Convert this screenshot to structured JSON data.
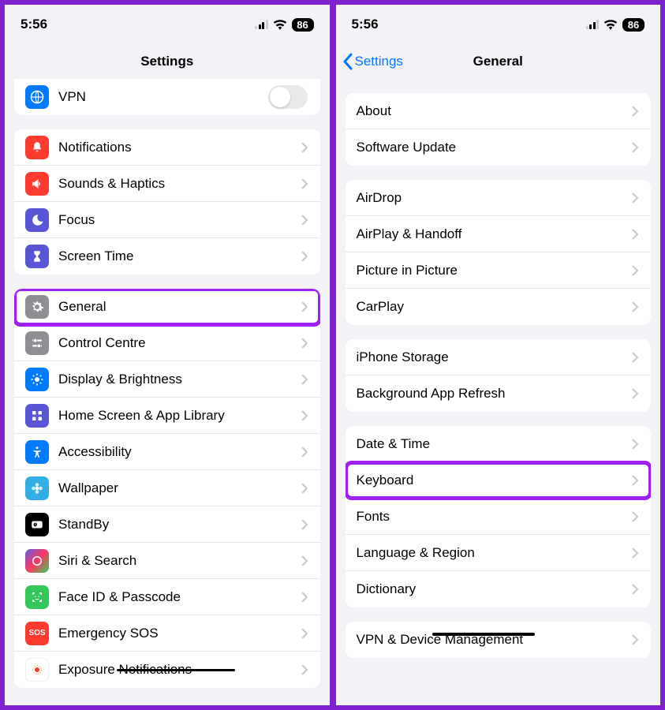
{
  "status": {
    "time": "5:56",
    "battery": "86"
  },
  "left": {
    "title": "Settings",
    "vpn": "VPN",
    "group2": [
      "Notifications",
      "Sounds & Haptics",
      "Focus",
      "Screen Time"
    ],
    "group3": [
      "General",
      "Control Centre",
      "Display & Brightness",
      "Home Screen & App Library",
      "Accessibility",
      "Wallpaper",
      "StandBy",
      "Siri & Search",
      "Face ID & Passcode",
      "Emergency SOS",
      "Exposure Notifications"
    ]
  },
  "right": {
    "back": "Settings",
    "title": "General",
    "g1": [
      "About",
      "Software Update"
    ],
    "g2": [
      "AirDrop",
      "AirPlay & Handoff",
      "Picture in Picture",
      "CarPlay"
    ],
    "g3": [
      "iPhone Storage",
      "Background App Refresh"
    ],
    "g4": [
      "Date & Time",
      "Keyboard",
      "Fonts",
      "Language & Region",
      "Dictionary"
    ],
    "g5": [
      "VPN & Device Management"
    ]
  }
}
